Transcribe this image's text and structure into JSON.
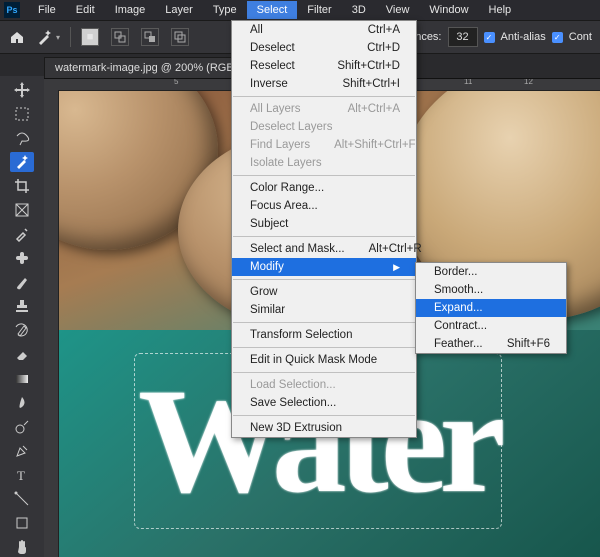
{
  "app": {
    "logo": "Ps"
  },
  "menubar": [
    "File",
    "Edit",
    "Image",
    "Layer",
    "Type",
    "Select",
    "Filter",
    "3D",
    "View",
    "Window",
    "Help"
  ],
  "menubar_open_index": 5,
  "options_bar": {
    "tolerance_label": "erances:",
    "tolerance_value": "32",
    "anti_alias_label": "Anti-alias",
    "contiguous_label": "Cont"
  },
  "document_tab": "watermark-image.jpg @ 200% (RGB",
  "ruler_marks": {
    "h": [
      "5",
      "11",
      "12"
    ]
  },
  "select_menu": {
    "groups": [
      [
        {
          "l": "All",
          "s": "Ctrl+A",
          "d": false
        },
        {
          "l": "Deselect",
          "s": "Ctrl+D",
          "d": false
        },
        {
          "l": "Reselect",
          "s": "Shift+Ctrl+D",
          "d": false
        },
        {
          "l": "Inverse",
          "s": "Shift+Ctrl+I",
          "d": false
        }
      ],
      [
        {
          "l": "All Layers",
          "s": "Alt+Ctrl+A",
          "d": true
        },
        {
          "l": "Deselect Layers",
          "s": "",
          "d": true
        },
        {
          "l": "Find Layers",
          "s": "Alt+Shift+Ctrl+F",
          "d": true
        },
        {
          "l": "Isolate Layers",
          "s": "",
          "d": true
        }
      ],
      [
        {
          "l": "Color Range...",
          "s": "",
          "d": false
        },
        {
          "l": "Focus Area...",
          "s": "",
          "d": false
        },
        {
          "l": "Subject",
          "s": "",
          "d": false
        }
      ],
      [
        {
          "l": "Select and Mask...",
          "s": "Alt+Ctrl+R",
          "d": false
        },
        {
          "l": "Modify",
          "s": "",
          "d": false,
          "sub": true,
          "sel": true
        }
      ],
      [
        {
          "l": "Grow",
          "s": "",
          "d": false
        },
        {
          "l": "Similar",
          "s": "",
          "d": false
        }
      ],
      [
        {
          "l": "Transform Selection",
          "s": "",
          "d": false
        }
      ],
      [
        {
          "l": "Edit in Quick Mask Mode",
          "s": "",
          "d": false
        }
      ],
      [
        {
          "l": "Load Selection...",
          "s": "",
          "d": true
        },
        {
          "l": "Save Selection...",
          "s": "",
          "d": false
        }
      ],
      [
        {
          "l": "New 3D Extrusion",
          "s": "",
          "d": false
        }
      ]
    ]
  },
  "modify_submenu": [
    {
      "l": "Border...",
      "s": ""
    },
    {
      "l": "Smooth...",
      "s": ""
    },
    {
      "l": "Expand...",
      "s": "",
      "sel": true
    },
    {
      "l": "Contract...",
      "s": ""
    },
    {
      "l": "Feather...",
      "s": "Shift+F6"
    }
  ],
  "watermark_text": "Water",
  "tool_icons": [
    "move",
    "marquee",
    "lasso",
    "wand-sel",
    "crop",
    "frame",
    "eyedrop",
    "heal",
    "brush",
    "stamp",
    "history",
    "eraser",
    "gradient",
    "blur",
    "dodge",
    "pen",
    "type",
    "path",
    "shape",
    "hand"
  ]
}
